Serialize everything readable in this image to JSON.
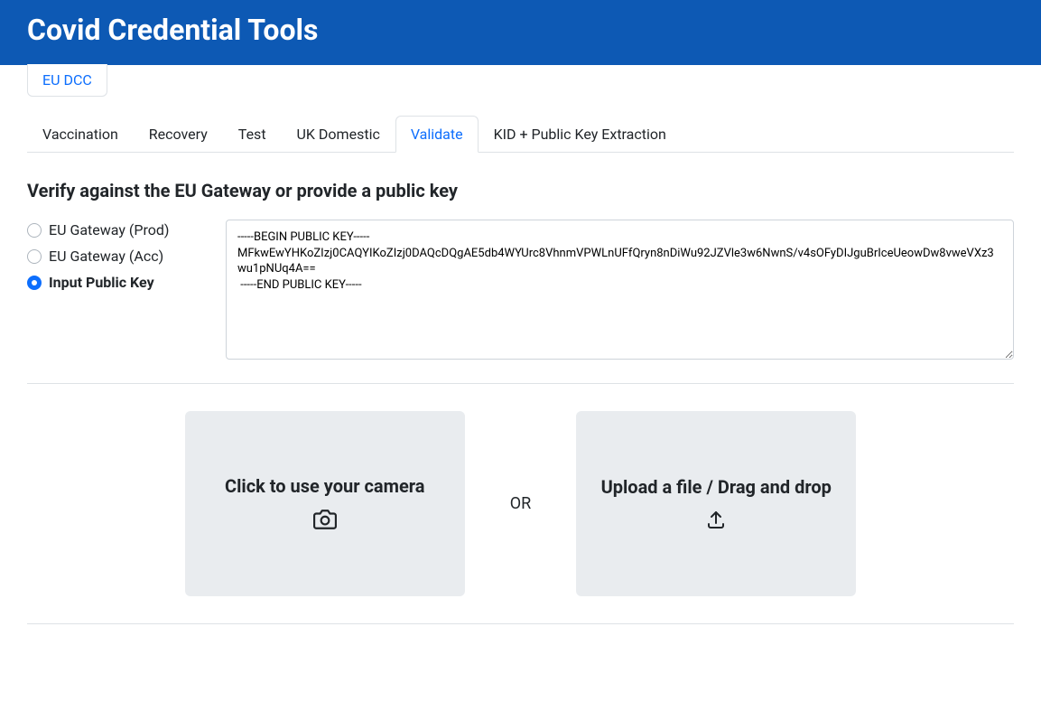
{
  "header": {
    "title": "Covid Credential Tools"
  },
  "topTabs": [
    {
      "label": "EU DCC",
      "active": true
    }
  ],
  "subTabs": [
    {
      "label": "Vaccination",
      "active": false
    },
    {
      "label": "Recovery",
      "active": false
    },
    {
      "label": "Test",
      "active": false
    },
    {
      "label": "UK Domestic",
      "active": false
    },
    {
      "label": "Validate",
      "active": true
    },
    {
      "label": "KID + Public Key Extraction",
      "active": false
    }
  ],
  "validate": {
    "heading": "Verify against the EU Gateway or provide a public key",
    "radios": [
      {
        "label": "EU Gateway (Prod)",
        "selected": false
      },
      {
        "label": "EU Gateway (Acc)",
        "selected": false
      },
      {
        "label": "Input Public Key",
        "selected": true
      }
    ],
    "publicKey": "-----BEGIN PUBLIC KEY-----\nMFkwEwYHKoZIzj0CAQYIKoZIzj0DAQcDQgAE5db4WYUrc8VhnmVPWLnUFfQryn8nDiWu92JZVle3w6NwnS/v4sOFyDIJguBrIceUeowDw8vweVXz3wu1pNUq4A==\n -----END PUBLIC KEY-----",
    "camera_label": "Click to use your camera",
    "or_label": "OR",
    "upload_label": "Upload a file / Drag and drop"
  }
}
